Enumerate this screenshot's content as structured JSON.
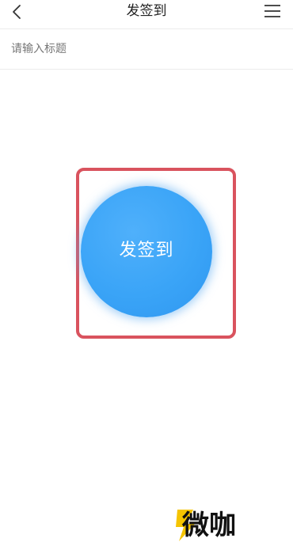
{
  "navbar": {
    "title": "发签到",
    "back_icon": "chevron-left-icon",
    "menu_icon": "hamburger-menu-icon"
  },
  "title_input": {
    "placeholder": "请输入标题",
    "value": ""
  },
  "signin_button": {
    "label": "发签到",
    "color": "#3aa4f7"
  },
  "highlight_frame": {
    "color": "#d9535e"
  },
  "watermark": {
    "text": "微咖",
    "accent_color": "#f5c400"
  }
}
